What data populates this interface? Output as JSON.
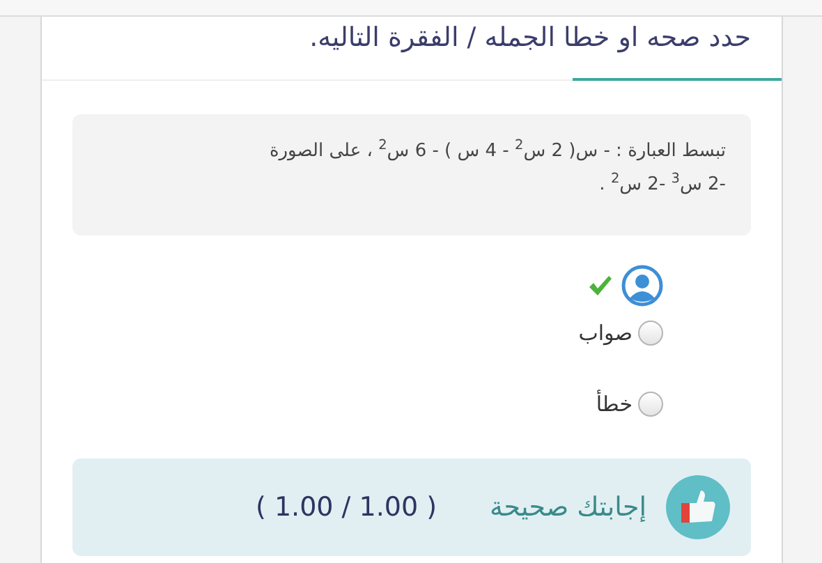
{
  "title": "حدد صحه او خطا الجمله / الفقرة التاليه.",
  "question": "تبسط العبارة :  - س( 2 س$^{2}$ - 4 س ) - 6 س$^{2}$  ، على الصورة -2 س$^{3}$ -2 س$^{2}$ .",
  "answer_marker": {
    "correct": true
  },
  "options": [
    {
      "label": "صواب",
      "selected": false
    },
    {
      "label": "خطأ",
      "selected": false
    }
  ],
  "feedback": {
    "kind": "correct",
    "message": "إجابتك صحيحة",
    "score": "( 1.00 / 1.00 )"
  }
}
